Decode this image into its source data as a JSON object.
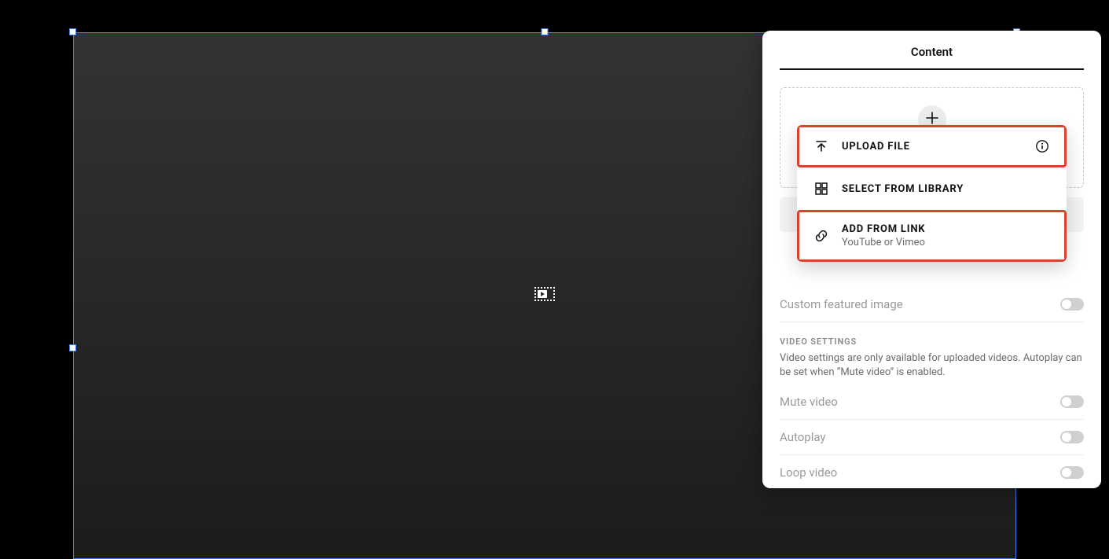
{
  "panel": {
    "tab_label": "Content",
    "menu": {
      "upload_file": "UPLOAD FILE",
      "select_from_library": "SELECT FROM LIBRARY",
      "add_from_link": "ADD FROM LINK",
      "add_from_link_sub": "YouTube or Vimeo"
    },
    "featured_image_label": "Custom featured image",
    "video_settings_title": "VIDEO SETTINGS",
    "video_settings_desc": "Video settings are only available for uploaded videos. Autoplay can be set when “Mute video” is enabled.",
    "mute_label": "Mute video",
    "autoplay_label": "Autoplay",
    "loop_label": "Loop video"
  },
  "toggles": {
    "featured_image": false,
    "mute": false,
    "autoplay": false,
    "loop": false
  }
}
